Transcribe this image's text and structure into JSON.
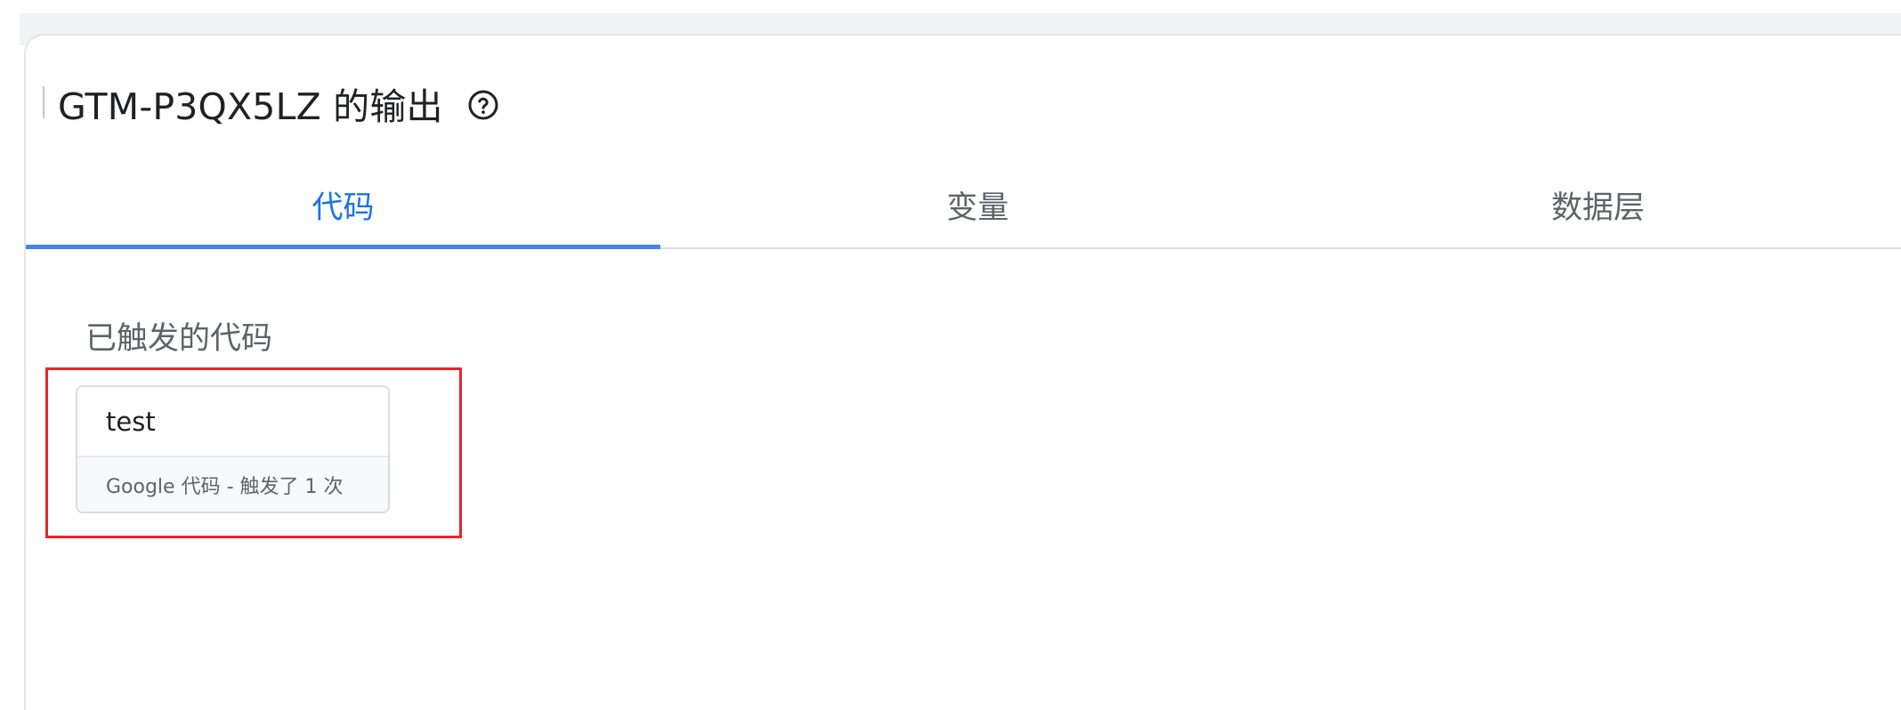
{
  "header": {
    "title": "GTM-P3QX5LZ 的输出",
    "help_icon": "help-circle-icon"
  },
  "tabs": [
    {
      "label": "代码",
      "active": true
    },
    {
      "label": "变量",
      "active": false
    },
    {
      "label": "数据层",
      "active": false
    }
  ],
  "fired_tags": {
    "section_title": "已触发的代码",
    "items": [
      {
        "name": "test",
        "meta": "Google 代码 - 触发了 1 次"
      }
    ]
  },
  "colors": {
    "accent": "#1a73e8",
    "tab_indicator": "#4285f4",
    "highlight": "#e5262a"
  }
}
